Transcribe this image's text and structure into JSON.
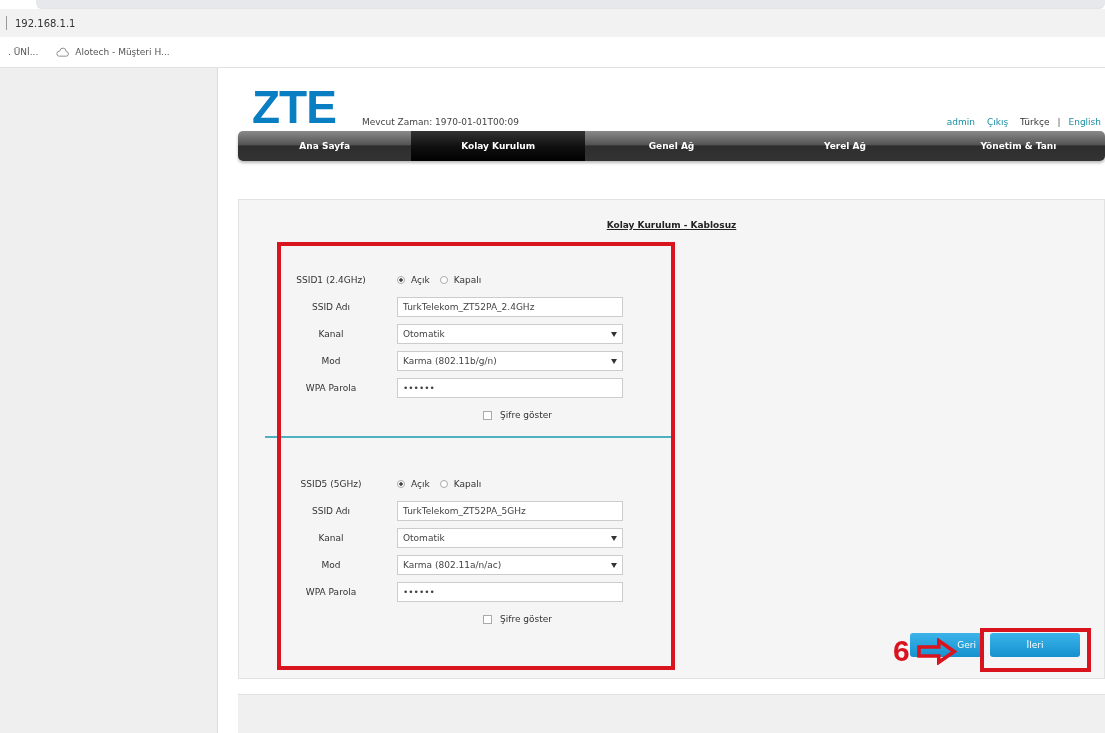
{
  "browser": {
    "address": "192.168.1.1",
    "bookmarks": [
      {
        "label": ". ÜNİ...",
        "has_icon": false
      },
      {
        "label": "Alotech - Müşteri H...",
        "has_icon": true
      }
    ]
  },
  "header": {
    "logo": "ZTE",
    "time": "Mevcut Zaman: 1970-01-01T00:09",
    "user_links": [
      "admin",
      "Çıkış"
    ],
    "separator": "|",
    "languages": [
      {
        "label": "Türkçe",
        "selected": true
      },
      {
        "label": "English",
        "selected": false
      }
    ]
  },
  "nav": {
    "tabs": [
      {
        "label": "Ana Sayfa",
        "selected": false
      },
      {
        "label": "Kolay Kurulum",
        "selected": true
      },
      {
        "label": "Genel Ağ",
        "selected": false
      },
      {
        "label": "Yerel Ağ",
        "selected": false
      },
      {
        "label": "Yönetim & Tanı",
        "selected": false
      }
    ]
  },
  "panel": {
    "title": "Kolay Kurulum - Kablosuz",
    "sections": [
      {
        "rows": [
          {
            "kind": "radio",
            "label": "SSID1 (2.4GHz)",
            "options": [
              {
                "label": "Açık",
                "selected": true
              },
              {
                "label": "Kapalı",
                "selected": false
              }
            ]
          },
          {
            "kind": "text",
            "label": "SSID Adı",
            "value": "TurkTelekom_ZT52PA_2.4GHz"
          },
          {
            "kind": "select",
            "label": "Kanal",
            "value": "Otomatik"
          },
          {
            "kind": "select",
            "label": "Mod",
            "value": "Karma (802.11b/g/n)"
          },
          {
            "kind": "text",
            "label": "WPA Parola",
            "value": "••••••"
          },
          {
            "kind": "checkbox",
            "label": "Şifre göster",
            "checked": false
          }
        ]
      },
      {
        "rows": [
          {
            "kind": "radio",
            "label": "SSID5 (5GHz)",
            "options": [
              {
                "label": "Açık",
                "selected": true
              },
              {
                "label": "Kapalı",
                "selected": false
              }
            ]
          },
          {
            "kind": "text",
            "label": "SSID Adı",
            "value": "TurkTelekom_ZT52PA_5GHz"
          },
          {
            "kind": "select",
            "label": "Kanal",
            "value": "Otomatik"
          },
          {
            "kind": "select",
            "label": "Mod",
            "value": "Karma (802.11a/n/ac)"
          },
          {
            "kind": "text",
            "label": "WPA Parola",
            "value": "••••••"
          },
          {
            "kind": "checkbox",
            "label": "Şifre göster",
            "checked": false
          }
        ]
      }
    ],
    "buttons": [
      "Geri",
      "İleri"
    ]
  },
  "annotation": {
    "step": "6"
  }
}
